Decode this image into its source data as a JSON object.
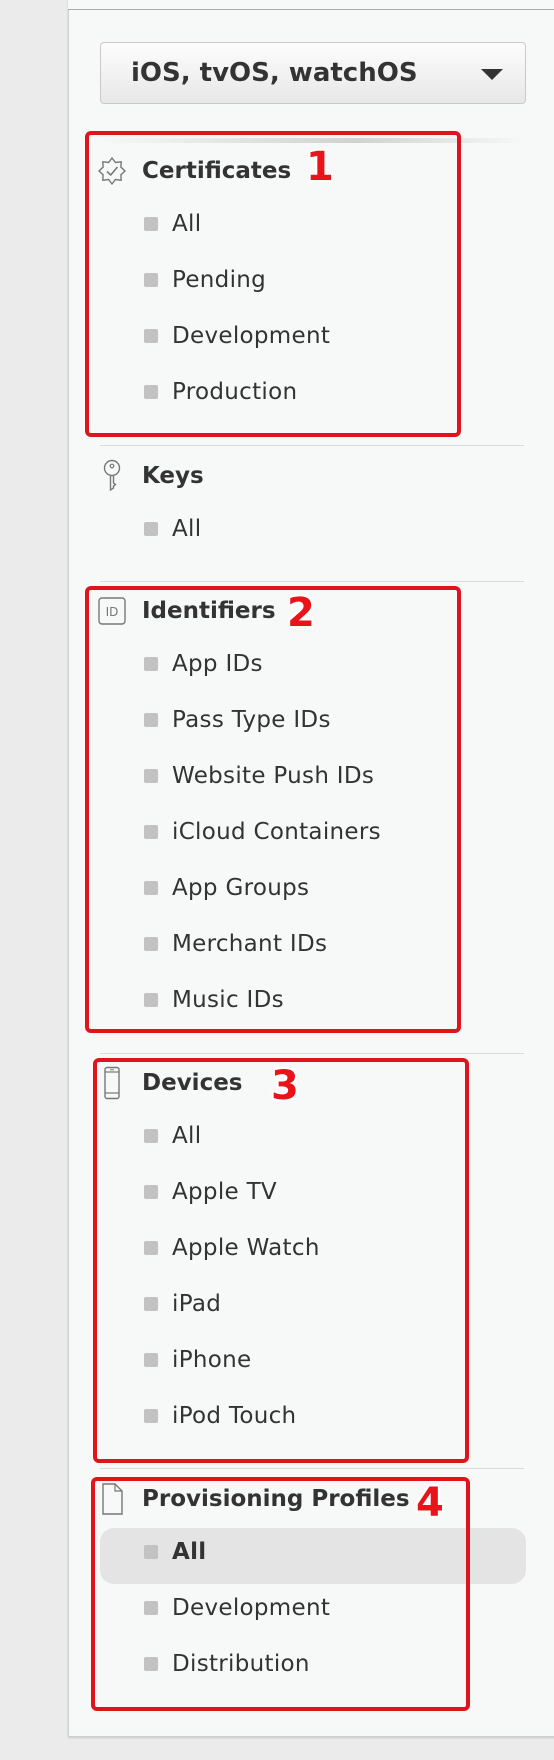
{
  "platform_selector": {
    "selected": "iOS, tvOS, watchOS",
    "icon": "chevron-down-icon"
  },
  "sections": {
    "certificates": {
      "title": "Certificates",
      "icon": "certificate-seal-icon",
      "items": [
        "All",
        "Pending",
        "Development",
        "Production"
      ]
    },
    "keys": {
      "title": "Keys",
      "icon": "key-icon",
      "items": [
        "All"
      ]
    },
    "identifiers": {
      "title": "Identifiers",
      "icon": "id-icon",
      "items": [
        "App IDs",
        "Pass Type IDs",
        "Website Push IDs",
        "iCloud Containers",
        "App Groups",
        "Merchant IDs",
        "Music IDs"
      ]
    },
    "devices": {
      "title": "Devices",
      "icon": "device-phone-icon",
      "items": [
        "All",
        "Apple TV",
        "Apple Watch",
        "iPad",
        "iPhone",
        "iPod Touch"
      ]
    },
    "profiles": {
      "title": "Provisioning Profiles",
      "icon": "document-icon",
      "items": [
        "All",
        "Development",
        "Distribution"
      ],
      "selected_item": "All"
    }
  },
  "callouts": [
    "1",
    "2",
    "3",
    "4"
  ],
  "colors": {
    "callout": "#e0141c",
    "bullet": "#c2c2c2",
    "selected_bg": "#e4e4e4",
    "text": "#333333"
  }
}
